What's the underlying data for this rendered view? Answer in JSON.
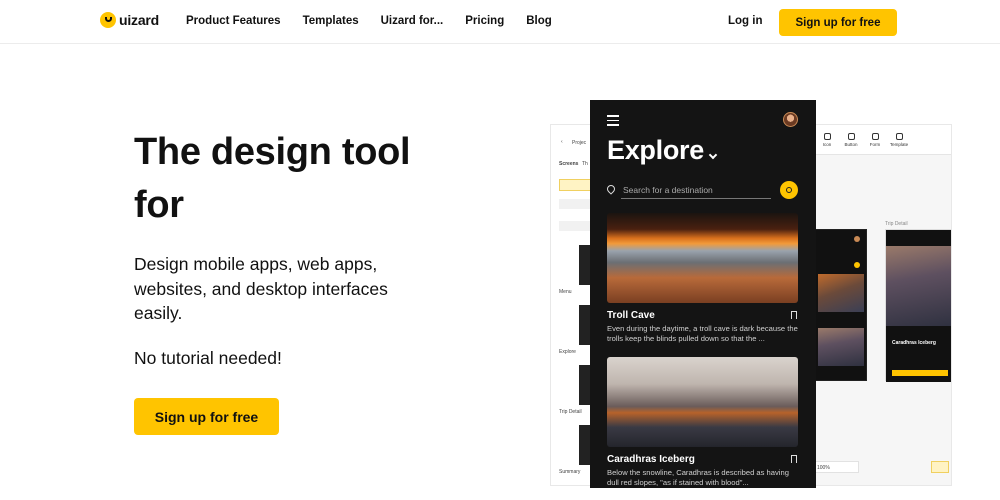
{
  "brand": {
    "logo_text": "uizard",
    "accent": "#ffc400"
  },
  "nav": {
    "links": [
      "Product Features",
      "Templates",
      "Uizard for...",
      "Pricing",
      "Blog"
    ],
    "login": "Log in",
    "signup": "Sign up for free"
  },
  "hero": {
    "title": "The design tool for",
    "subtitle": "Design mobile apps, web apps, websites, and desktop interfaces easily.",
    "note": "No tutorial needed!",
    "cta": "Sign up for free"
  },
  "editor": {
    "project": "Projec",
    "tabs": [
      "Screens",
      "Th"
    ],
    "screens": [
      "Menu",
      "Explore",
      "Trip Detail",
      "Summary"
    ],
    "tools": [
      "Icon",
      "Button",
      "Form",
      "Template"
    ],
    "frame_label": "Trip Detail",
    "mini_title": "Caradhras Iceberg",
    "zoom": "100%"
  },
  "phone": {
    "title": "Explore",
    "search_placeholder": "Search for a destination",
    "cards": [
      {
        "title": "Troll Cave",
        "desc": "Even during the daytime, a troll cave is dark because the trolls keep the blinds pulled down so that the ..."
      },
      {
        "title": "Caradhras Iceberg",
        "desc": "Below the snowline, Caradhras is described as having dull red slopes, \"as if stained with blood\"..."
      }
    ]
  }
}
